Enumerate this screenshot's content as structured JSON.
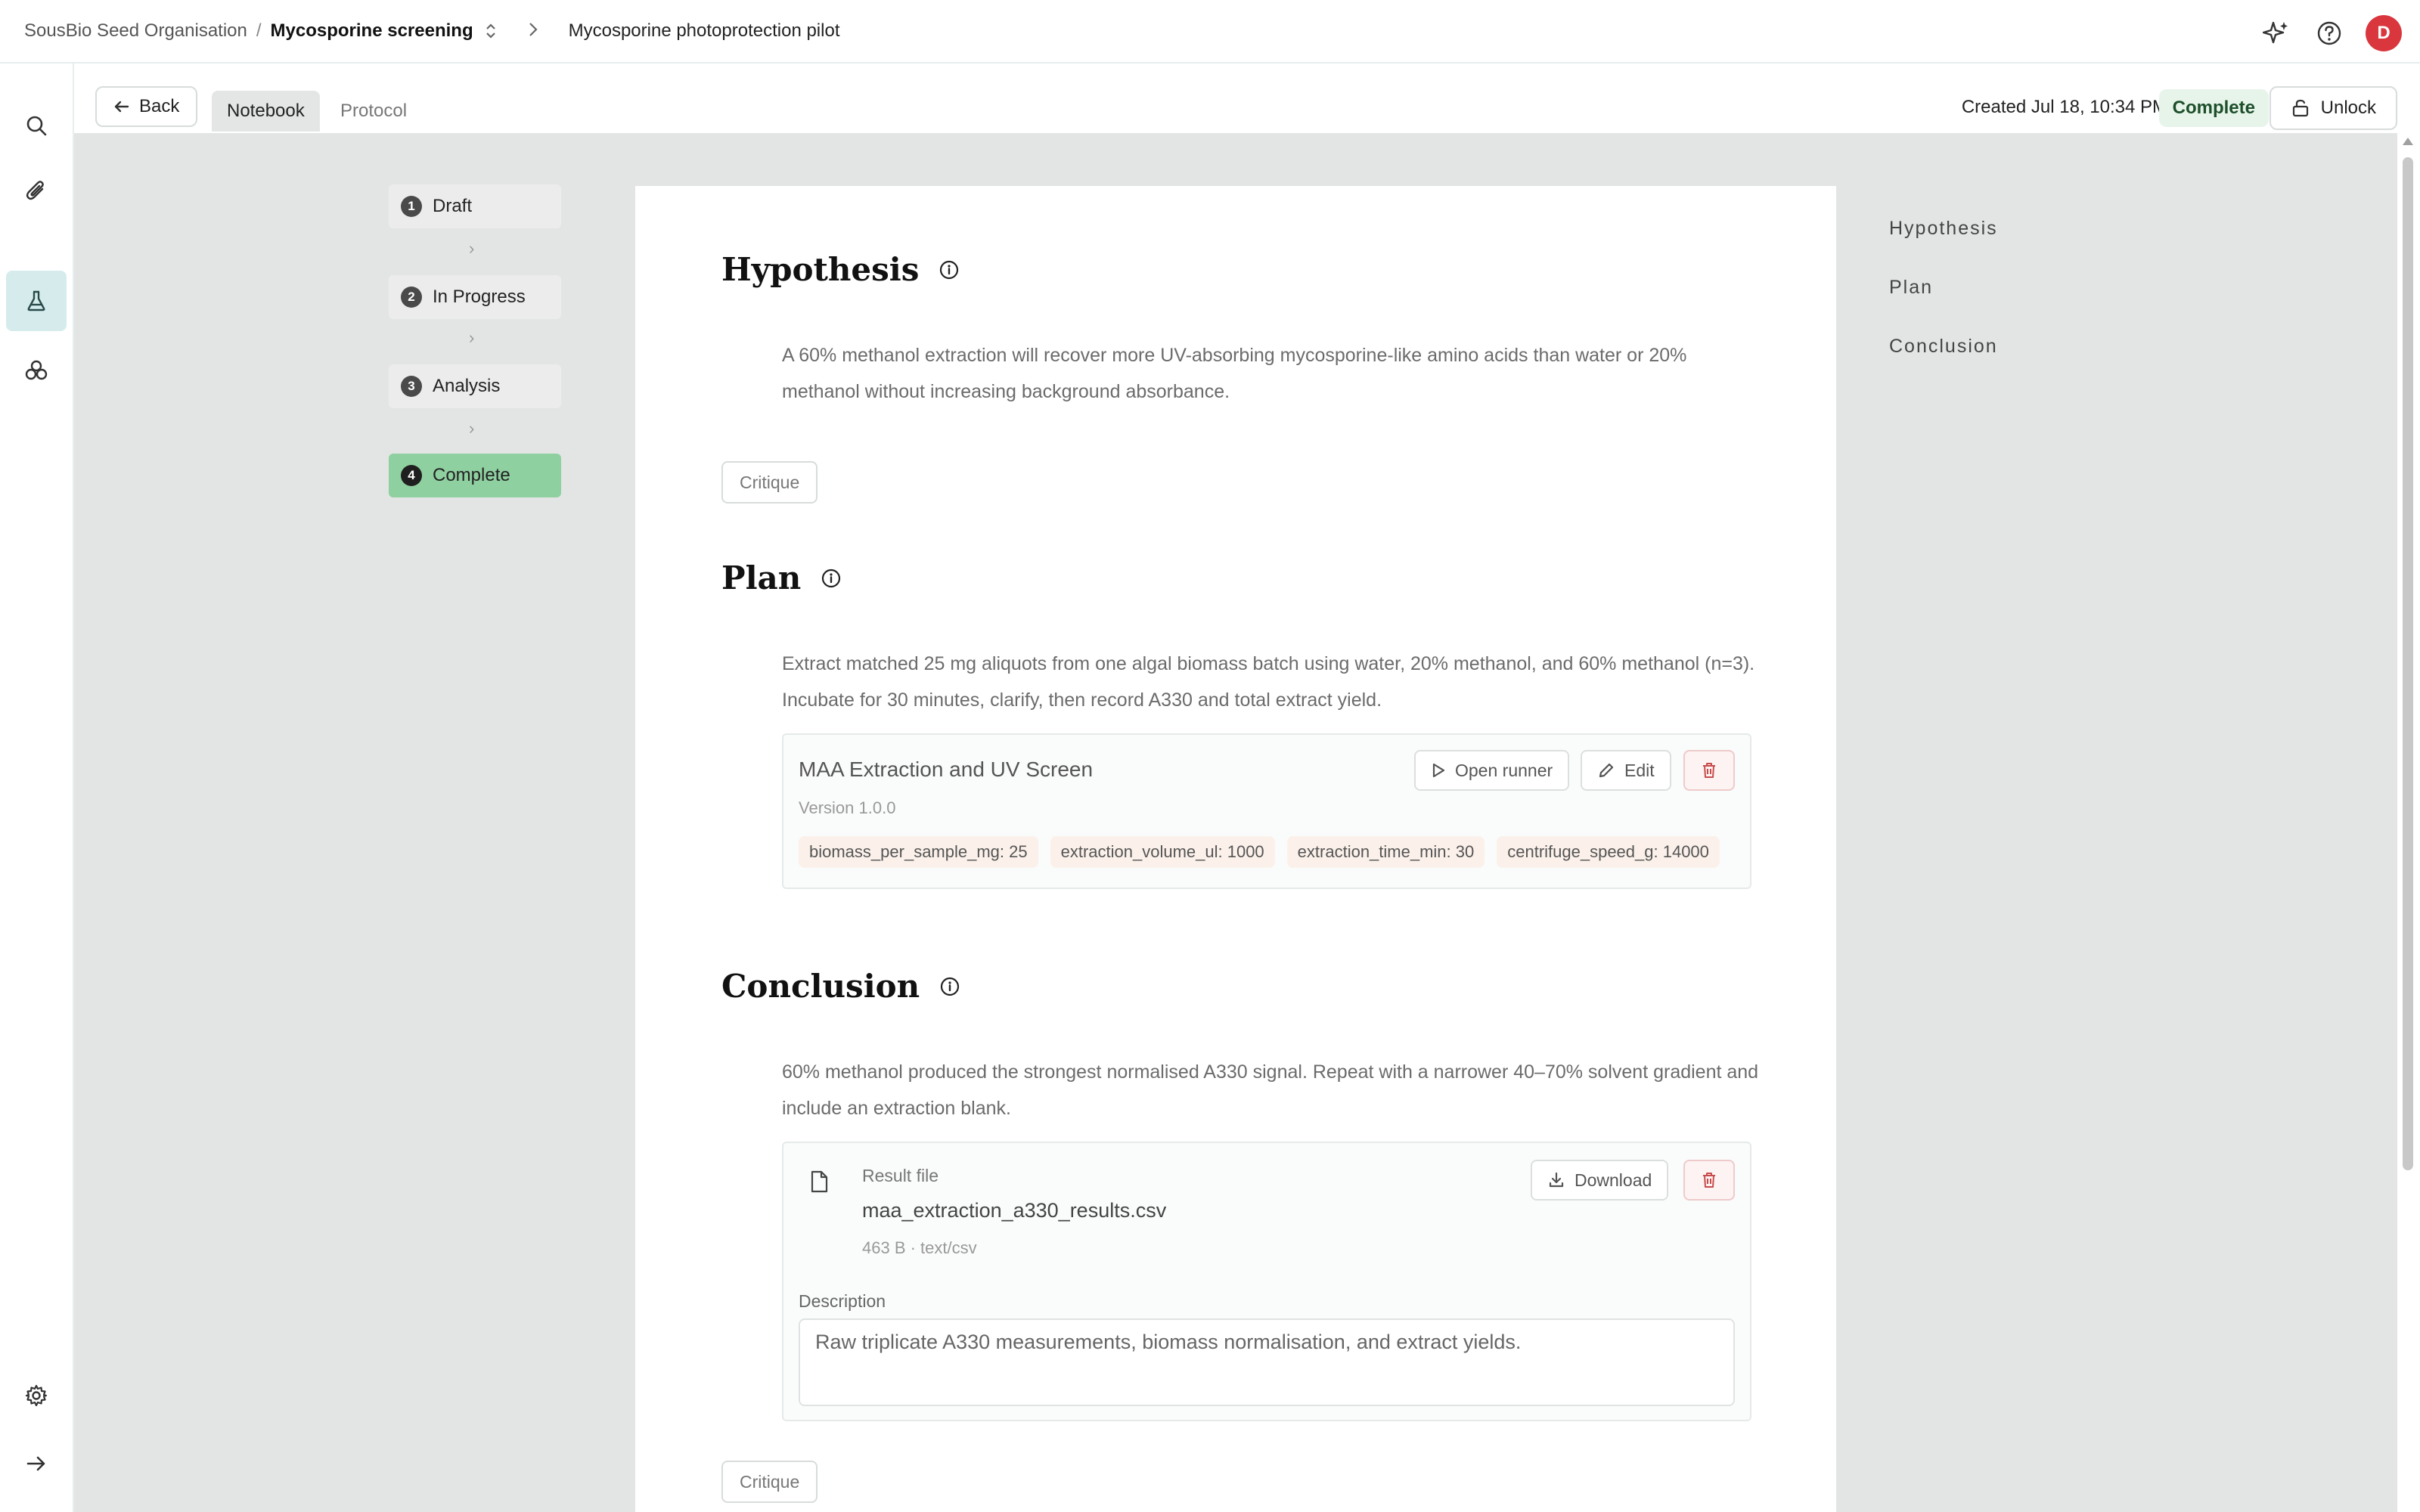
{
  "header": {
    "org": "SousBio Seed Organisation",
    "separator": "/",
    "project": "Mycosporine screening",
    "page": "Mycosporine photoprotection pilot",
    "avatar_initial": "D"
  },
  "subheader": {
    "back_label": "Back",
    "tabs": [
      {
        "label": "Notebook",
        "active": true
      },
      {
        "label": "Protocol",
        "active": false
      }
    ],
    "created": "Created Jul 18, 10:34 PM",
    "status": "Complete",
    "unlock_label": "Unlock"
  },
  "stepper": {
    "steps": [
      {
        "num": "1",
        "label": "Draft"
      },
      {
        "num": "2",
        "label": "In Progress"
      },
      {
        "num": "3",
        "label": "Analysis"
      },
      {
        "num": "4",
        "label": "Complete"
      }
    ],
    "arrow": "›"
  },
  "hypothesis": {
    "title": "Hypothesis",
    "text": "A 60% methanol extraction will recover more UV-absorbing mycosporine-like amino acids than water or 20% methanol without increasing background absorbance.",
    "critique_label": "Critique"
  },
  "plan": {
    "title": "Plan",
    "text": "Extract matched 25 mg aliquots from one algal biomass batch using water, 20% methanol, and 60% methanol (n=3). Incubate for 30 minutes, clarify, then record A330 and total extract yield.",
    "protocol": {
      "name": "MAA Extraction and UV Screen",
      "version": "Version 1.0.0",
      "open_runner_label": "Open runner",
      "edit_label": "Edit",
      "params": [
        "biomass_per_sample_mg: 25",
        "extraction_volume_ul: 1000",
        "extraction_time_min: 30",
        "centrifuge_speed_g: 14000"
      ]
    }
  },
  "conclusion": {
    "title": "Conclusion",
    "text": "60% methanol produced the strongest normalised A330 signal. Repeat with a narrower 40–70% solvent gradient and include an extraction blank.",
    "file": {
      "label": "Result file",
      "name": "maa_extraction_a330_results.csv",
      "meta": "463 B · text/csv",
      "download_label": "Download",
      "description_label": "Description",
      "description": "Raw triplicate A330 measurements, biomass normalisation, and extract yields."
    },
    "critique_label": "Critique"
  },
  "toc": [
    "Hypothesis",
    "Plan",
    "Conclusion"
  ],
  "colors": {
    "accent_active": "#d6ecec",
    "complete_step": "#8fd0a0",
    "avatar": "#d9363e",
    "status_bg": "#e7f4ea"
  }
}
